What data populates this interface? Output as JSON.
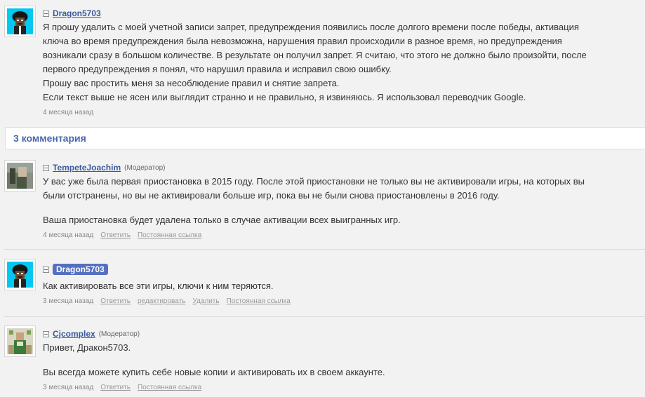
{
  "question": {
    "author": "Dragon5703",
    "paragraphs": [
      "Я прошу удалить с моей учетной записи запрет, предупреждения появились после долгого времени после победы, активация",
      "ключа во время предупреждения была невозможна, нарушения правил происходили в разное время, но предупреждения",
      "возникали сразу в большом количестве. В результате он получил запрет. Я считаю, что этого не должно было произойти, после",
      "первого предупреждения я понял, что нарушил правила и исправил свою ошибку.",
      "Прошу вас простить меня за несоблюдение правил и снятие запрета.",
      "Если текст выше не ясен или выглядит странно и не правильно, я извиняюсь. Я использовал переводчик Google."
    ],
    "time": "4 месяца назад"
  },
  "comments_header": "3 комментария",
  "comments": [
    {
      "author": "TempeteJoachim",
      "role": "(Модератор)",
      "lines_p1": [
        "У вас уже была первая приостановка в 2015 году. После этой приостановки не только вы не активировали игры, на которых вы",
        "были отстранены, но вы не активировали больше игр, пока вы не были снова приостановлены в 2016 году."
      ],
      "lines_p2": [
        "Ваша приостановка будет удалена только в случае активации всех выигранных игр."
      ],
      "time": "4 месяца назад",
      "actions": [
        "Ответить",
        "Постоянная ссылка"
      ]
    },
    {
      "author": "Dragon5703",
      "role": "",
      "lines_p1": [
        "Как активировать все эти игры, ключи к ним теряются."
      ],
      "lines_p2": [],
      "time": "3 месяца назад",
      "actions": [
        "Ответить",
        "редактировать",
        "Удалить",
        "Постоянная ссылка"
      ]
    },
    {
      "author": "Cjcomplex",
      "role": "(Модератор)",
      "lines_p1": [
        "Привет, Дракон5703."
      ],
      "lines_p2": [
        "Вы всегда можете купить себе новые копии и активировать их в своем аккаунте."
      ],
      "time": "3 месяца назад",
      "actions": [
        "Ответить",
        "Постоянная ссылка"
      ]
    }
  ],
  "colors": {
    "link": "#3a5a9d",
    "badge": "#5570c0",
    "header_text": "#4a68ad",
    "avatar_cyan": "#00c8f0"
  }
}
